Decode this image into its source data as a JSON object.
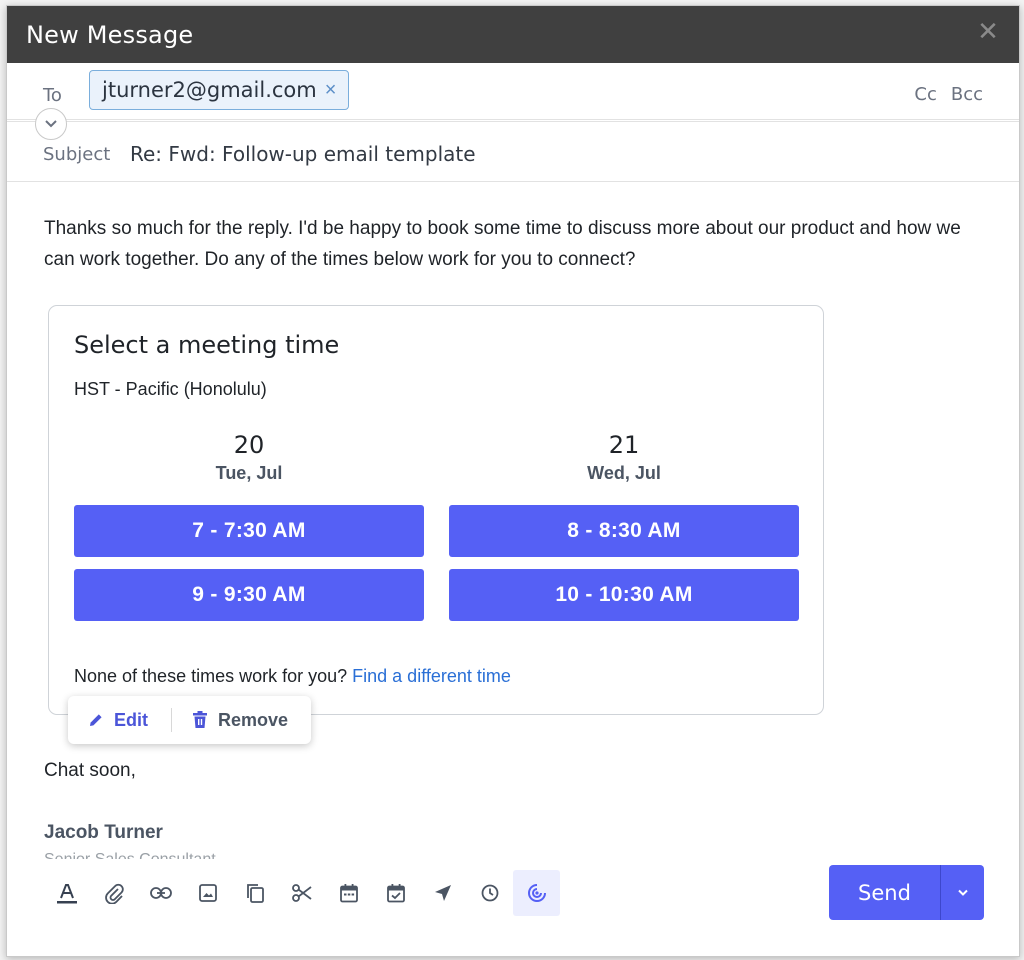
{
  "window": {
    "title": "New Message"
  },
  "to": {
    "label": "To",
    "recipients": [
      "jturner2@gmail.com"
    ],
    "cc_label": "Cc",
    "bcc_label": "Bcc"
  },
  "subject": {
    "label": "Subject",
    "value": "Re: Fwd: Follow-up email template"
  },
  "body": {
    "paragraph": "Thanks so much for the reply. I'd be happy to book some time to discuss more about our product and how we can work together. Do any of the times below work for you to connect?",
    "closing": "Chat soon,",
    "signature_name": "Jacob Turner",
    "signature_title": "Senior Sales Consultant"
  },
  "meeting_card": {
    "title": "Select a meeting time",
    "timezone": "HST - Pacific (Honolulu)",
    "days": [
      {
        "num": "20",
        "name": "Tue, Jul"
      },
      {
        "num": "21",
        "name": "Wed, Jul"
      }
    ],
    "slots": [
      "7 - 7:30 AM",
      "8 - 8:30 AM",
      "9 - 9:30 AM",
      "10 - 10:30 AM"
    ],
    "none_text": "None of these times work for you?",
    "none_link": "Find a different time"
  },
  "card_popover": {
    "edit_label": "Edit",
    "remove_label": "Remove"
  },
  "toolbar": {
    "icons": [
      "text-format-icon",
      "attach-icon",
      "link-icon",
      "image-icon",
      "copy-icon",
      "scissors-icon",
      "calendar-icon",
      "calendar-check-icon",
      "send-plane-icon",
      "clock-icon",
      "meeting-target-icon"
    ]
  },
  "send": {
    "label": "Send"
  },
  "colors": {
    "accent": "#5560f5",
    "link": "#2a6fd6",
    "titlebar": "#404040",
    "chip_bg": "#eaf2fb"
  }
}
